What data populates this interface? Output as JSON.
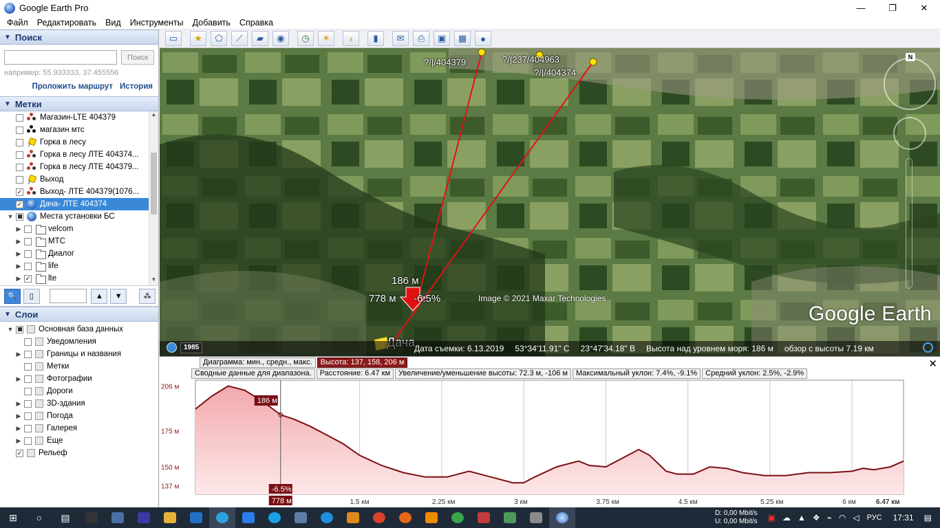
{
  "window": {
    "title": "Google Earth Pro",
    "minimize": "—",
    "restore": "❐",
    "close": "✕"
  },
  "menu": [
    "Файл",
    "Редактировать",
    "Вид",
    "Инструменты",
    "Добавить",
    "Справка"
  ],
  "search": {
    "header": "Поиск",
    "button": "Поиск",
    "hint": "например: 55.933333, 37.455556",
    "route": "Проложить маршрут",
    "history": "История"
  },
  "places": {
    "header": "Метки",
    "items": [
      {
        "label": "Магазин-LTE 404379",
        "icon": "dots",
        "checked": false,
        "indent": 0
      },
      {
        "label": "магазин мтс",
        "icon": "dotsblack",
        "checked": false,
        "indent": 0
      },
      {
        "label": "Горка в лесу",
        "icon": "pin",
        "checked": false,
        "indent": 0
      },
      {
        "label": "Горка в лесу ЛТЕ 404374...",
        "icon": "dots",
        "checked": false,
        "indent": 0
      },
      {
        "label": "Горка в лесу ЛТЕ 404379...",
        "icon": "dots",
        "checked": false,
        "indent": 0
      },
      {
        "label": "Выход",
        "icon": "pin",
        "checked": false,
        "indent": 0
      },
      {
        "label": "Выход- ЛТЕ 404379(1076...",
        "icon": "dots",
        "checked": true,
        "indent": 0
      },
      {
        "label": "Дача- ЛТЕ 404374",
        "icon": "globe",
        "checked": true,
        "indent": 0,
        "selected": true
      },
      {
        "label": "Места установки БС",
        "icon": "globe",
        "checked": "partial",
        "indent": 0,
        "expander": "▼"
      },
      {
        "label": "velcom",
        "icon": "folder",
        "checked": false,
        "indent": 1,
        "expander": "▶"
      },
      {
        "label": "МТС",
        "icon": "folder",
        "checked": false,
        "indent": 1,
        "expander": "▶"
      },
      {
        "label": "Диалог",
        "icon": "folder",
        "checked": false,
        "indent": 1,
        "expander": "▶"
      },
      {
        "label": "life",
        "icon": "folder",
        "checked": false,
        "indent": 1,
        "expander": "▶"
      },
      {
        "label": "lte",
        "icon": "folder",
        "checked": true,
        "indent": 1,
        "expander": "▶"
      }
    ]
  },
  "layers": {
    "header": "Слои",
    "items": [
      {
        "label": "Основная база данных",
        "checked": "partial",
        "expander": "▼",
        "indent": 0
      },
      {
        "label": "Уведомления",
        "checked": false,
        "indent": 1
      },
      {
        "label": "Границы и названия",
        "checked": false,
        "expander": "▶",
        "indent": 1
      },
      {
        "label": "Метки",
        "checked": false,
        "indent": 1
      },
      {
        "label": "Фотографии",
        "checked": false,
        "expander": "▶",
        "indent": 1
      },
      {
        "label": "Дороги",
        "checked": false,
        "indent": 1
      },
      {
        "label": "3D-здания",
        "checked": false,
        "expander": "▶",
        "indent": 1
      },
      {
        "label": "Погода",
        "checked": false,
        "expander": "▶",
        "indent": 1
      },
      {
        "label": "Галерея",
        "checked": false,
        "expander": "▶",
        "indent": 1
      },
      {
        "label": "Еще",
        "checked": false,
        "expander": "▶",
        "indent": 1
      },
      {
        "label": "Рельеф",
        "checked": true,
        "indent": 0
      }
    ]
  },
  "map": {
    "labels": {
      "p1": "?/|/404379",
      "p2": "?/|237/404963",
      "p3": "?/|/404374",
      "elev": "186 м",
      "dist": "778 м",
      "slope": "-6.5%",
      "dacha": "Дача"
    },
    "copyright": "Image © 2021 Maxar Technologies",
    "brand": "Google Earth",
    "north": "N",
    "year": "1985",
    "status": {
      "date": "Дата съемки: 6.13.2019",
      "lat": "53°34'11.91\" С",
      "lon": "23°47'34.18\" В",
      "alt": "Высота над уровнем моря:   186 м",
      "eye": "обзор с высоты   7.19 км"
    }
  },
  "profile": {
    "row1": {
      "label": "Диаграмма: мин., средн., макс.",
      "value": "Высота: 137, 158, 206 м"
    },
    "row2": {
      "label": "Сводные данные для диапазона.",
      "distance": "Расстояние: 6.47 км",
      "gain": "Увеличение/уменьшение высоты: 72.3 м, -106 м",
      "maxslope": "Максимальный уклон: 7.4%, -9.1%",
      "avgslope": "Средний уклон: 2.5%, -2.9%"
    },
    "close": "✕",
    "cursor": {
      "elev": "186 м",
      "slope": "-6.5%",
      "dist": "778 м"
    }
  },
  "chart_data": {
    "type": "area",
    "x": [
      0,
      0.15,
      0.3,
      0.45,
      0.6,
      0.78,
      0.9,
      1.05,
      1.2,
      1.35,
      1.5,
      1.7,
      1.9,
      2.1,
      2.3,
      2.5,
      2.7,
      2.9,
      3.0,
      3.1,
      3.3,
      3.5,
      3.6,
      3.75,
      3.9,
      4.05,
      4.15,
      4.3,
      4.4,
      4.55,
      4.7,
      4.85,
      5.0,
      5.2,
      5.4,
      5.6,
      5.8,
      6.0,
      6.1,
      6.2,
      6.35,
      6.47
    ],
    "y": [
      190,
      199,
      206,
      203,
      196,
      186,
      183,
      178,
      172,
      166,
      158,
      151,
      146,
      143,
      143,
      147,
      143,
      139,
      139,
      143,
      150,
      154,
      151,
      150,
      156,
      162,
      158,
      147,
      145,
      145,
      150,
      149,
      146,
      144,
      144,
      146,
      146,
      147,
      149,
      148,
      150,
      154
    ],
    "xlabel": "",
    "ylabel": "",
    "ylim": [
      131,
      210
    ],
    "xlim": [
      0,
      6.47
    ],
    "yticks": [
      {
        "v": 206,
        "label": "206 м"
      },
      {
        "v": 175,
        "label": "175 м"
      },
      {
        "v": 150,
        "label": "150 м"
      },
      {
        "v": 137,
        "label": "137 м"
      }
    ],
    "xticks": [
      {
        "v": 1.5,
        "label": "1.5 км"
      },
      {
        "v": 2.25,
        "label": "2.25 км"
      },
      {
        "v": 3,
        "label": "3 км"
      },
      {
        "v": 3.75,
        "label": "3.75 км"
      },
      {
        "v": 4.5,
        "label": "4.5 км"
      },
      {
        "v": 5.25,
        "label": "5.25 км"
      },
      {
        "v": 6,
        "label": "6 км"
      },
      {
        "v": 6.47,
        "label": "6.47 км"
      }
    ],
    "cursor_x": 0.778,
    "grid": true,
    "colors": {
      "line": "#7a0f14",
      "fill": "#f6c6c8"
    }
  },
  "taskbar": {
    "net_d": "D:   0,00 Mbit/s",
    "net_u": "U:   0,00 Mbit/s",
    "lang": "РУС",
    "time": "17:31"
  }
}
